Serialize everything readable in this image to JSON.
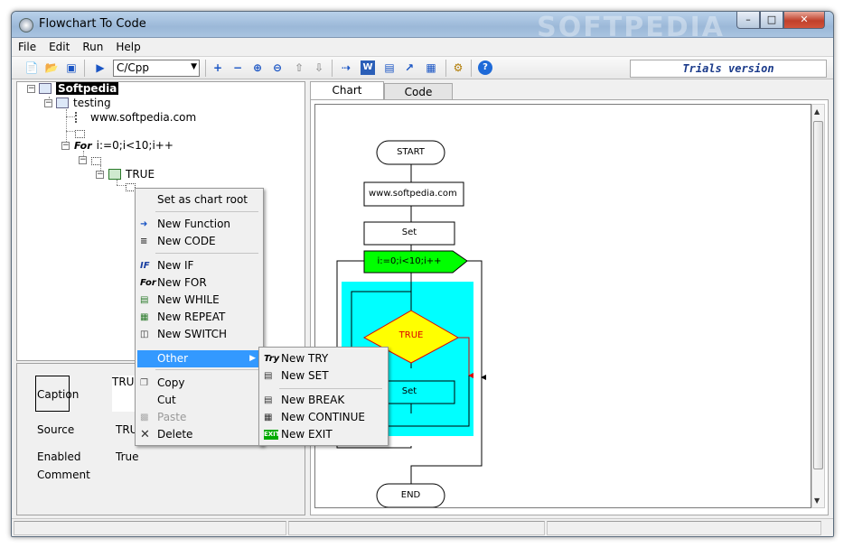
{
  "window": {
    "title": "Flowchart To Code",
    "watermark": "SOFTPEDIA"
  },
  "menu": [
    "File",
    "Edit",
    "Run",
    "Help"
  ],
  "toolbar": {
    "language": "C/Cpp",
    "trial_label": "Trials version"
  },
  "tree": {
    "root": "Softpedia",
    "function": "testing",
    "code": "www.softpedia.com",
    "for": "i:=0;i<10;i++",
    "true_branch": "TRUE",
    "for_tag": "For"
  },
  "props": {
    "caption_label": "Caption",
    "caption_value": "TRUE",
    "source_label": "Source",
    "source_value": "TRUE",
    "enabled_label": "Enabled",
    "enabled_value": "True",
    "comment_label": "Comment"
  },
  "tabs": [
    "Chart",
    "Code"
  ],
  "flowchart": {
    "start": "START",
    "code": "www.softpedia.com",
    "set": "Set",
    "for": "i:=0;i<10;i++",
    "decision": "TRUE",
    "inner_set": "Set",
    "end": "END"
  },
  "context_menu": {
    "set_root": "Set as chart root",
    "new_function": "New Function",
    "new_code": "New CODE",
    "new_if": "New IF",
    "new_for": "New FOR",
    "new_while": "New WHILE",
    "new_repeat": "New REPEAT",
    "new_switch": "New SWITCH",
    "other": "Other",
    "copy": "Copy",
    "cut": "Cut",
    "paste": "Paste",
    "delete": "Delete",
    "if_glyph": "IF",
    "for_glyph": "For"
  },
  "submenu": {
    "new_try": "New TRY",
    "new_set": "New SET",
    "new_break": "New BREAK",
    "new_continue": "New CONTINUE",
    "new_exit": "New EXIT",
    "try_glyph": "Try",
    "exit_glyph": "EXIT"
  },
  "colors": {
    "for_block": "#00ff00",
    "loop_body": "#00ffff",
    "decision": "#ffff00",
    "decision_text": "#ff0000",
    "highlight": "#3399ff"
  }
}
